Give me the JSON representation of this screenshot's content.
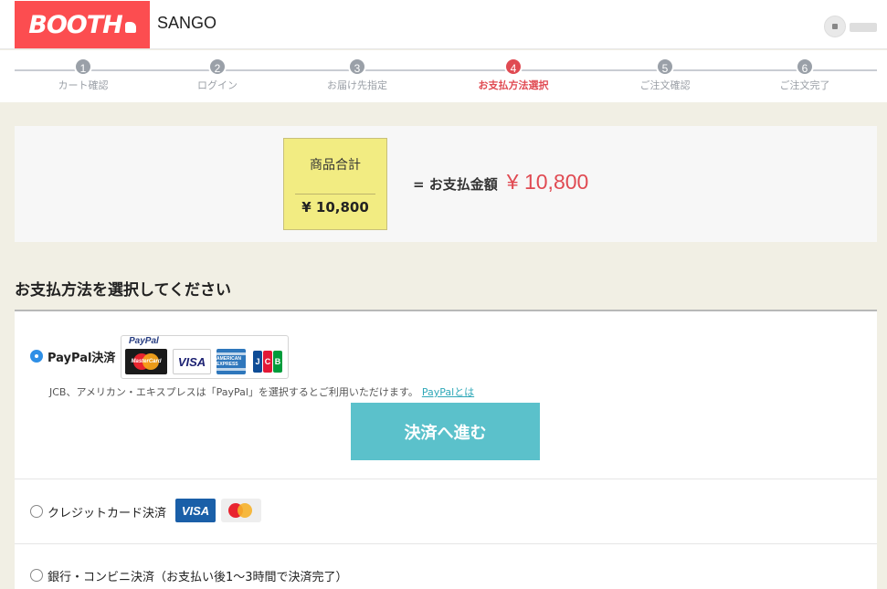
{
  "header": {
    "logo": "BOOTH",
    "shop_name": "SANGO"
  },
  "stepper": {
    "steps": [
      {
        "num": "1",
        "label": "カート確認"
      },
      {
        "num": "2",
        "label": "ログイン"
      },
      {
        "num": "3",
        "label": "お届け先指定"
      },
      {
        "num": "4",
        "label": "お支払方法選択"
      },
      {
        "num": "5",
        "label": "ご注文確認"
      },
      {
        "num": "6",
        "label": "ご注文完了"
      }
    ],
    "active_step": 4
  },
  "summary": {
    "subtotal_label": "商品合計",
    "subtotal_value": "¥ 10,800",
    "total_label": "= お支払金額",
    "total_value": "¥ 10,800"
  },
  "section_title": "お支払方法を選択してください",
  "payment": {
    "paypal": {
      "label": "PayPal決済",
      "brand": "PayPal",
      "card_mastercard": "MasterCard",
      "card_visa": "VISA",
      "card_amex": "AMERICAN EXPRESS",
      "card_jcb": [
        "J",
        "C",
        "B"
      ],
      "note": "JCB、アメリカン・エキスプレスは「PayPal」を選択するとご利用いただけます。",
      "link": "PayPalとは",
      "button": "決済へ進む",
      "selected": true
    },
    "credit": {
      "label": "クレジットカード決済",
      "card_visa": "VISA",
      "selected": false
    },
    "bank": {
      "label": "銀行・コンビニ決済（お支払い後1〜3時間で決済完了）",
      "selected": false
    }
  },
  "colors": {
    "brand": "#fc4d50",
    "accent_red": "#e04a52",
    "button": "#5bc1cb",
    "radio_selected": "#2f8fe6",
    "total_box": "#f2ec82"
  }
}
